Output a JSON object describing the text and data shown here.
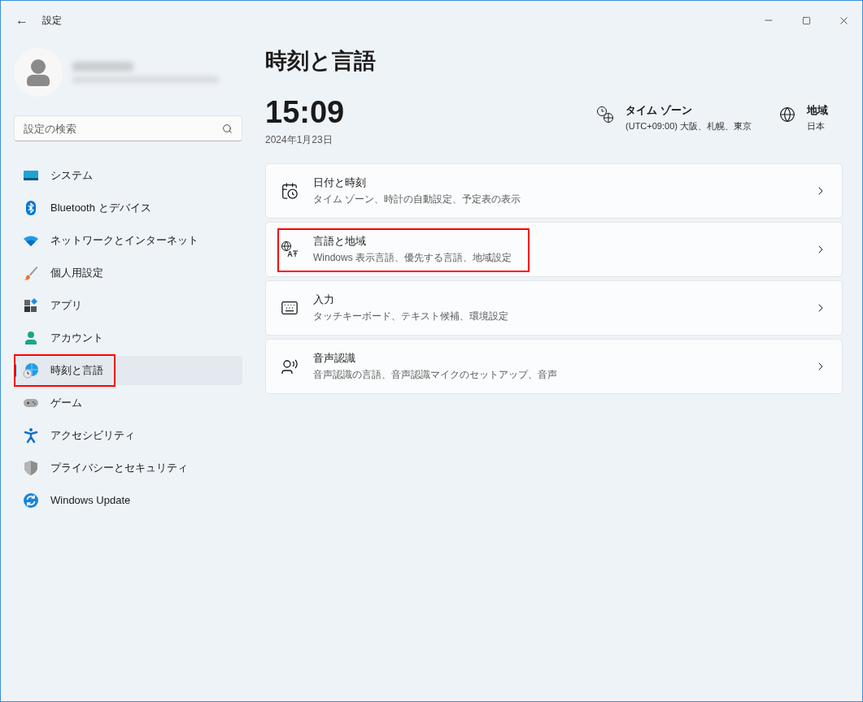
{
  "window": {
    "title": "設定",
    "back": "←"
  },
  "search": {
    "placeholder": "設定の検索"
  },
  "sidebar": {
    "items": [
      {
        "label": "システム",
        "selected": false,
        "highlighted": false
      },
      {
        "label": "Bluetooth とデバイス",
        "selected": false,
        "highlighted": false
      },
      {
        "label": "ネットワークとインターネット",
        "selected": false,
        "highlighted": false
      },
      {
        "label": "個人用設定",
        "selected": false,
        "highlighted": false
      },
      {
        "label": "アプリ",
        "selected": false,
        "highlighted": false
      },
      {
        "label": "アカウント",
        "selected": false,
        "highlighted": false
      },
      {
        "label": "時刻と言語",
        "selected": true,
        "highlighted": true
      },
      {
        "label": "ゲーム",
        "selected": false,
        "highlighted": false
      },
      {
        "label": "アクセシビリティ",
        "selected": false,
        "highlighted": false
      },
      {
        "label": "プライバシーとセキュリティ",
        "selected": false,
        "highlighted": false
      },
      {
        "label": "Windows Update",
        "selected": false,
        "highlighted": false
      }
    ]
  },
  "page": {
    "title": "時刻と言語",
    "time": "15:09",
    "date": "2024年1月23日",
    "info": [
      {
        "label": "タイム ゾーン",
        "value": "(UTC+09:00) 大阪、札幌、東京"
      },
      {
        "label": "地域",
        "value": "日本"
      }
    ],
    "cards": [
      {
        "title": "日付と時刻",
        "subtitle": "タイム ゾーン、時計の自動設定、予定表の表示",
        "highlighted": false
      },
      {
        "title": "言語と地域",
        "subtitle": "Windows 表示言語、優先する言語、地域設定",
        "highlighted": true
      },
      {
        "title": "入力",
        "subtitle": "タッチキーボード、テキスト候補、環境設定",
        "highlighted": false
      },
      {
        "title": "音声認識",
        "subtitle": "音声認識の言語、音声認識マイクのセットアップ、音声",
        "highlighted": false
      }
    ]
  }
}
